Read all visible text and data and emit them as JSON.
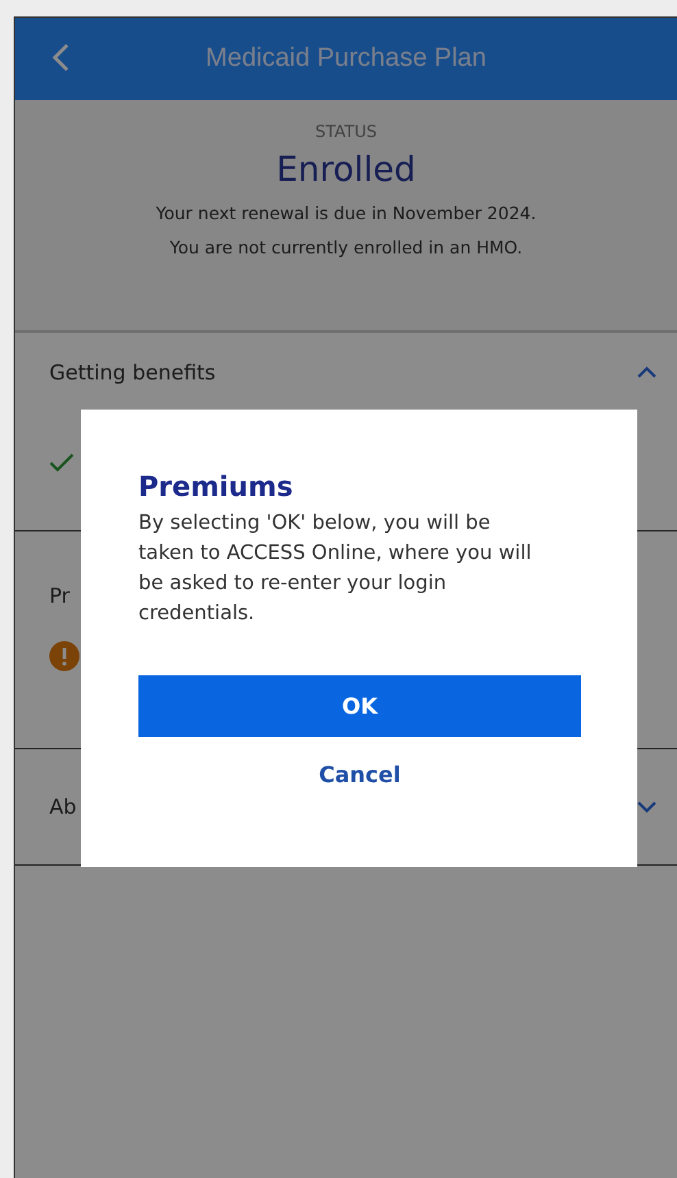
{
  "header": {
    "title": "Medicaid Purchase Plan"
  },
  "status": {
    "label": "STATUS",
    "value": "Enrolled",
    "lines": [
      "Your next renewal is due in November 2024.",
      "You are not currently enrolled in an HMO."
    ]
  },
  "sections": [
    {
      "title": "Getting benefits",
      "expanded": true,
      "items": [
        {
          "kind": "check"
        }
      ]
    },
    {
      "title": "Pr",
      "items": [
        {
          "kind": "alert"
        }
      ]
    },
    {
      "title": "Ab",
      "expanded": false
    }
  ],
  "dialog": {
    "title": "Premiums",
    "message": "By selecting 'OK' below, you will be taken to ACCESS Online, where you will be asked to re-enter your login credentials.",
    "buttons": [
      {
        "label": "OK",
        "kind": "primary"
      },
      {
        "label": "Cancel",
        "kind": "link"
      }
    ]
  }
}
